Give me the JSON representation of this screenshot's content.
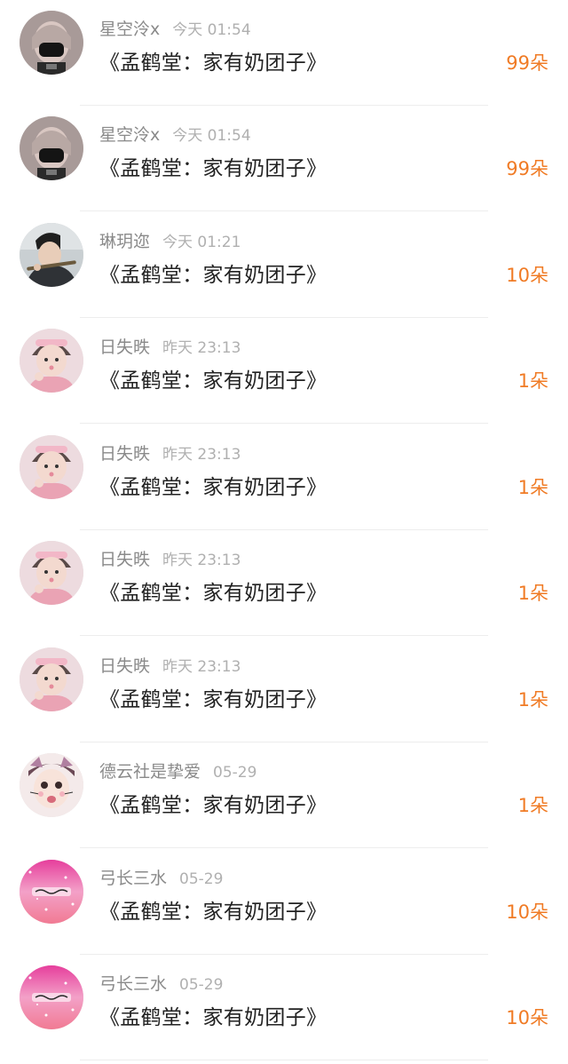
{
  "items": [
    {
      "name": "星空泠x",
      "time": "今天 01:54",
      "title": "《孟鹤堂：家有奶团子》",
      "flowers": "99朵",
      "avatar": "avatar-masked-person-icon"
    },
    {
      "name": "星空泠x",
      "time": "今天 01:54",
      "title": "《孟鹤堂：家有奶团子》",
      "flowers": "99朵",
      "avatar": "avatar-masked-person-icon"
    },
    {
      "name": "琳玥迩",
      "time": "今天 01:21",
      "title": "《孟鹤堂：家有奶团子》",
      "flowers": "10朵",
      "avatar": "avatar-man-playing-flute-icon"
    },
    {
      "name": "日失昳",
      "time": "昨天 23:13",
      "title": "《孟鹤堂：家有奶团子》",
      "flowers": "1朵",
      "avatar": "avatar-child-pink-icon"
    },
    {
      "name": "日失昳",
      "time": "昨天 23:13",
      "title": "《孟鹤堂：家有奶团子》",
      "flowers": "1朵",
      "avatar": "avatar-child-pink-icon"
    },
    {
      "name": "日失昳",
      "time": "昨天 23:13",
      "title": "《孟鹤堂：家有奶团子》",
      "flowers": "1朵",
      "avatar": "avatar-child-pink-icon"
    },
    {
      "name": "日失昳",
      "time": "昨天 23:13",
      "title": "《孟鹤堂：家有奶团子》",
      "flowers": "1朵",
      "avatar": "avatar-child-pink-icon"
    },
    {
      "name": "德云社是挚爱",
      "time": "05-29",
      "title": "《孟鹤堂：家有奶团子》",
      "flowers": "1朵",
      "avatar": "avatar-cartoon-face-icon"
    },
    {
      "name": "弓长三水",
      "time": "05-29",
      "title": "《孟鹤堂：家有奶团子》",
      "flowers": "10朵",
      "avatar": "avatar-pink-glitter-icon"
    },
    {
      "name": "弓长三水",
      "time": "05-29",
      "title": "《孟鹤堂：家有奶团子》",
      "flowers": "10朵",
      "avatar": "avatar-pink-glitter-icon"
    }
  ],
  "colors": {
    "username": "#8a8a8a",
    "time": "#b0b0b0",
    "title": "#222222",
    "flowers": "#f07b25",
    "divider": "#ededed"
  }
}
